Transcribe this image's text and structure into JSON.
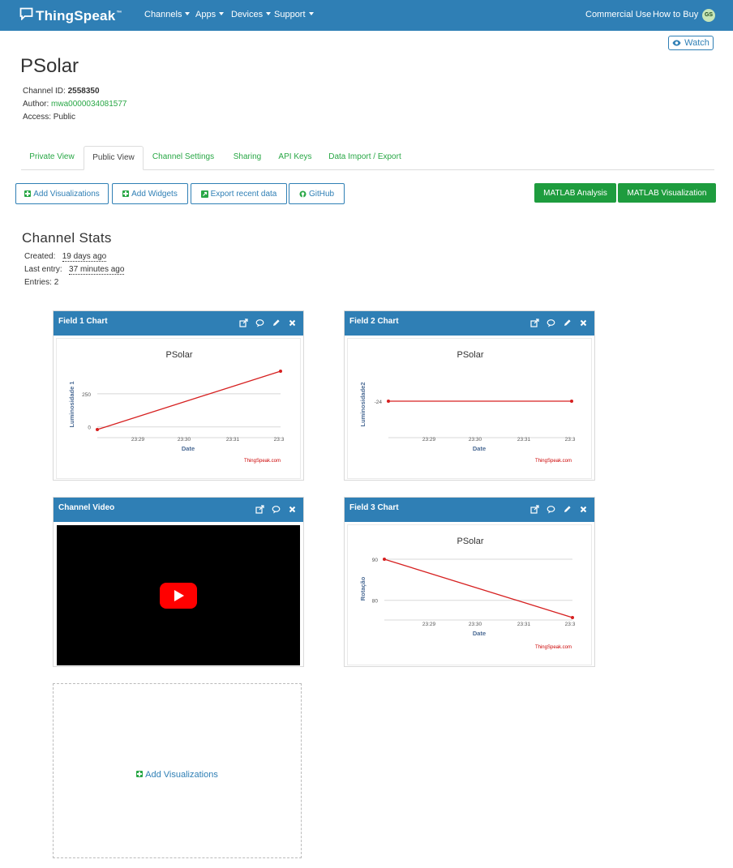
{
  "nav": {
    "brand": "ThingSpeak",
    "tm": "™",
    "menus": [
      "Channels",
      "Apps",
      "Devices",
      "Support"
    ],
    "commercial_use": "Commercial Use",
    "how_to_buy": "How to Buy",
    "avatar_initials": "GS"
  },
  "watch_label": "Watch",
  "channel": {
    "title": "PSolar",
    "id_label": "Channel ID:",
    "id_value": "2558350",
    "author_label": "Author:",
    "author_value": "mwa0000034081577",
    "access_label": "Access:",
    "access_value": "Public"
  },
  "tabs": [
    "Private View",
    "Public View",
    "Channel Settings",
    "Sharing",
    "API Keys",
    "Data Import / Export"
  ],
  "active_tab": "Public View",
  "buttons": {
    "add_visualizations": "Add Visualizations",
    "add_widgets": "Add Widgets",
    "export_recent": "Export recent data",
    "github": "GitHub",
    "matlab_analysis": "MATLAB Analysis",
    "matlab_visualization": "MATLAB Visualization"
  },
  "stats": {
    "title": "Channel Stats",
    "created_label": "Created:",
    "created_value": "19 days ago",
    "last_entry_label": "Last entry:",
    "last_entry_value": "37 minutes ago",
    "entries_label": "Entries:",
    "entries_value": "2"
  },
  "widgets": {
    "field1_title": "Field 1 Chart",
    "field2_title": "Field 2 Chart",
    "field3_title": "Field 3 Chart",
    "video_title": "Channel Video",
    "add_visualizations": "Add Visualizations"
  },
  "chart_data": [
    {
      "type": "line",
      "title": "PSolar",
      "xlabel": "Date",
      "ylabel": "Luminosidade 1",
      "x_ticks": [
        "23:29",
        "23:30",
        "23:31",
        "23:3"
      ],
      "y_ticks": [
        "0",
        "250"
      ],
      "series": [
        {
          "values": [
            -20,
            420
          ]
        }
      ],
      "line_color": "#d62020",
      "credit": "ThingSpeak.com"
    },
    {
      "type": "line",
      "title": "PSolar",
      "xlabel": "Date",
      "ylabel": "Luminosidade2",
      "x_ticks": [
        "23:29",
        "23:30",
        "23:31",
        "23:3"
      ],
      "y_ticks": [
        "-24"
      ],
      "series": [
        {
          "values": [
            -24,
            -24
          ]
        }
      ],
      "line_color": "#d62020",
      "credit": "ThingSpeak.com"
    },
    {
      "type": "line",
      "title": "PSolar",
      "xlabel": "Date",
      "ylabel": "Rotação",
      "x_ticks": [
        "23:29",
        "23:30",
        "23:31",
        "23:3"
      ],
      "y_ticks": [
        "90",
        "80"
      ],
      "series": [
        {
          "values": [
            90,
            75.8
          ]
        }
      ],
      "line_color": "#d62020",
      "credit": "ThingSpeak.com"
    }
  ],
  "colors": {
    "navbar": "#2f7fb5",
    "accent_green": "#28a745",
    "button_green": "#1e9c3e",
    "youtube_red": "#ff0000"
  }
}
